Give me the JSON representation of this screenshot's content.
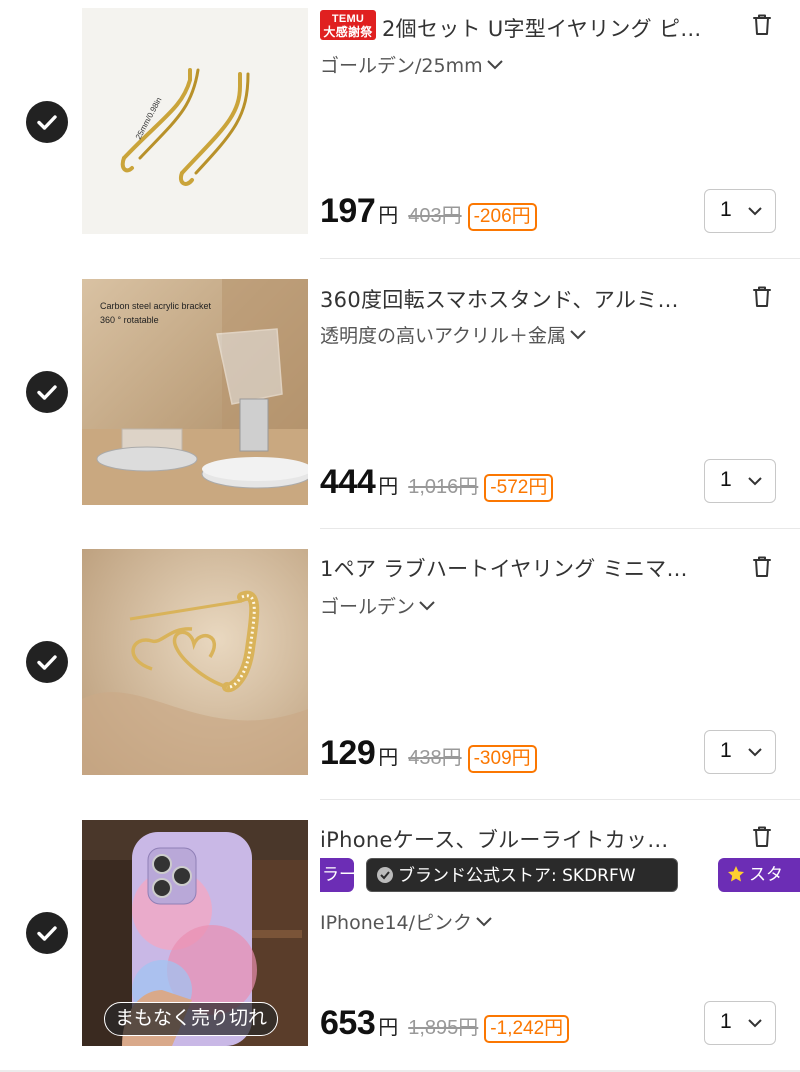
{
  "items": [
    {
      "title": "2個セット U字型イヤリング ピ…",
      "promo_tag_top": "TEMU",
      "promo_tag_bottom": "大感謝祭",
      "variant": "ゴールデン/25mm",
      "image_text": "25mm/0.98in",
      "price": "197",
      "currency": "円",
      "original_price": "403円",
      "discount": "-206円",
      "quantity": "1"
    },
    {
      "title": "360度回転スマホスタンド、アルミ…",
      "variant": "透明度の高いアクリル＋金属",
      "image_text_1": "Carbon steel acrylic bracket",
      "image_text_2": "360 ° rotatable",
      "price": "444",
      "currency": "円",
      "original_price": "1,016円",
      "discount": "-572円",
      "quantity": "1"
    },
    {
      "title": "1ペア ラブハートイヤリング ミニマ…",
      "variant": "ゴールデン",
      "price": "129",
      "currency": "円",
      "original_price": "438円",
      "discount": "-309円",
      "quantity": "1"
    },
    {
      "title": "iPhoneケース、ブルーライトカッ…",
      "badges": {
        "left": "ラー",
        "middle": "ブランド公式ストア: SKDRFW",
        "right": "スタ"
      },
      "variant": "IPhone14/ピンク",
      "sold_out_label": "まもなく売り切れ",
      "price": "653",
      "currency": "円",
      "original_price": "1,895円",
      "discount": "-1,242円",
      "quantity": "1"
    }
  ],
  "colors": {
    "accent_orange": "#fb7701",
    "promo_purple": "#6c2db5",
    "temu_red": "#e02020",
    "check_dark": "#222222"
  },
  "icons": [
    "check-circle-icon",
    "trash-icon",
    "chevron-down-icon",
    "verified-badge-icon",
    "star-icon"
  ]
}
